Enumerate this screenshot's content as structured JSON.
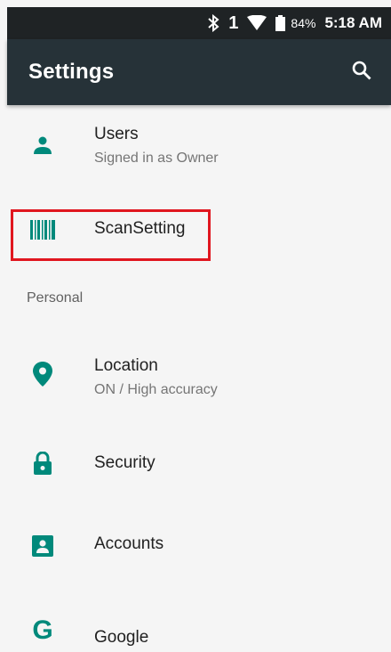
{
  "status_bar": {
    "bluetooth_icon": "bluetooth-icon",
    "sim_indicator": "1",
    "wifi_icon": "wifi-icon",
    "battery_icon": "battery-icon",
    "battery_percent": "84%",
    "time": "5:18 AM"
  },
  "app_bar": {
    "title": "Settings",
    "search_icon": "search-icon"
  },
  "settings": {
    "users": {
      "icon": "person-icon",
      "title": "Users",
      "subtitle": "Signed in as Owner"
    },
    "scan": {
      "icon": "barcode-icon",
      "title": "ScanSetting"
    },
    "personal_header": "Personal",
    "location": {
      "icon": "location-pin-icon",
      "title": "Location",
      "subtitle": "ON / High accuracy"
    },
    "security": {
      "icon": "lock-icon",
      "title": "Security"
    },
    "accounts": {
      "icon": "account-box-icon",
      "title": "Accounts"
    },
    "google": {
      "icon": "google-icon",
      "icon_glyph": "G",
      "title": "Google"
    }
  },
  "colors": {
    "status_bar_bg": "#1f2325",
    "app_bar_bg": "#263238",
    "accent": "#00897b",
    "highlight": "#e0161f",
    "background": "#f5f5f5"
  }
}
